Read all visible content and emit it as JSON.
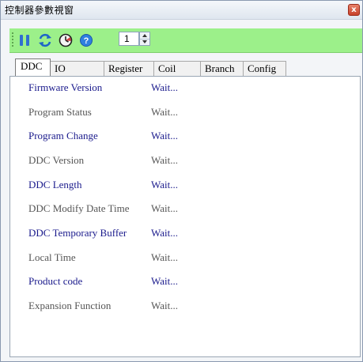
{
  "window": {
    "title": "控制器參數視窗",
    "close_label": "x"
  },
  "toolbar": {
    "icons": [
      "pause-icon",
      "refresh-icon",
      "timer-icon",
      "help-icon"
    ],
    "page_value": "1"
  },
  "tabs": [
    {
      "label": "DDC",
      "active": true
    },
    {
      "label": "IO"
    },
    {
      "label": "Register"
    },
    {
      "label": "Coil"
    },
    {
      "label": "Branch"
    },
    {
      "label": "Config"
    }
  ],
  "params": [
    {
      "label": "Firmware Version",
      "value": "Wait..."
    },
    {
      "label": "Program Status",
      "value": "Wait..."
    },
    {
      "label": "Program Change",
      "value": "Wait..."
    },
    {
      "label": "DDC Version",
      "value": "Wait..."
    },
    {
      "label": "DDC Length",
      "value": "Wait..."
    },
    {
      "label": "DDC Modify Date Time",
      "value": "Wait..."
    },
    {
      "label": "DDC Temporary Buffer",
      "value": "Wait..."
    },
    {
      "label": "Local Time",
      "value": "Wait..."
    },
    {
      "label": "Product code",
      "value": "Wait..."
    },
    {
      "label": "Expansion Function",
      "value": "Wait..."
    }
  ],
  "colors": {
    "toolbar_bg": "#9cf08a",
    "label_blue": "#1a1a8c",
    "label_gray": "#555555"
  }
}
